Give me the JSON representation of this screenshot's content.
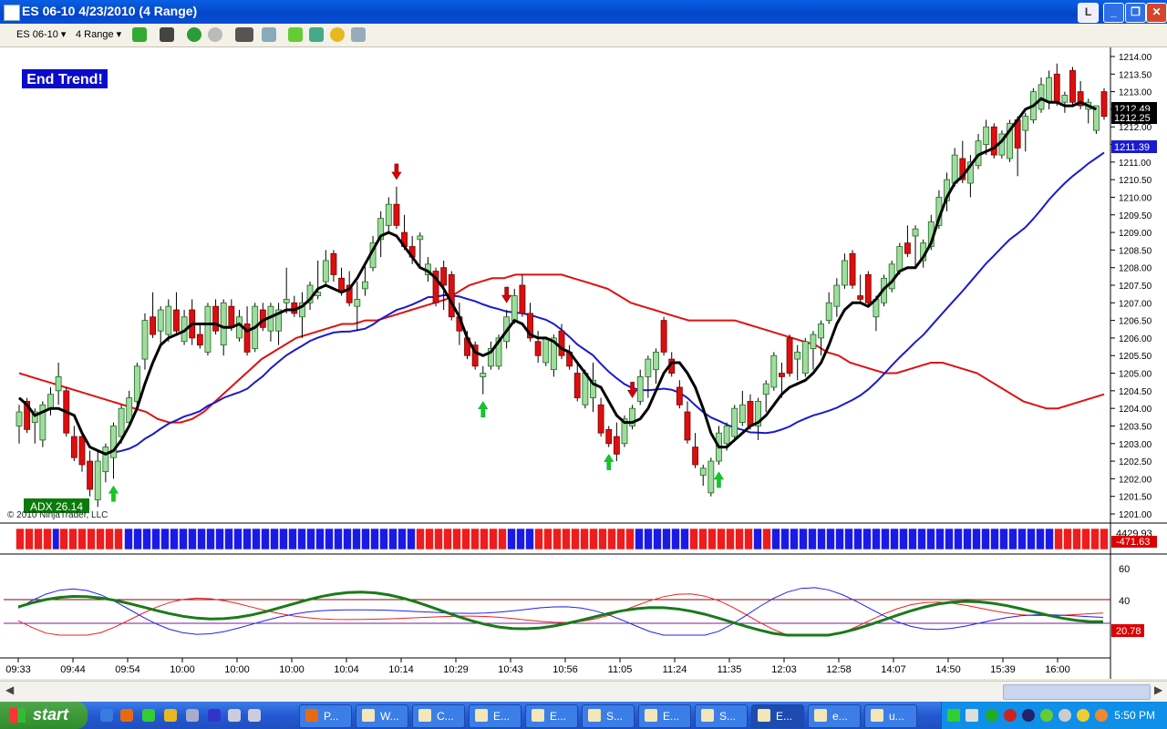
{
  "window": {
    "title": "ES 06-10  4/23/2010 (4 Range)",
    "buttons": [
      "L",
      "_",
      "❐",
      "✕"
    ]
  },
  "toolbar": {
    "instrument": "ES 06-10",
    "period": "4 Range"
  },
  "chart": {
    "banner": "End Trend!",
    "adx_label": "ADX 26.14",
    "copyright": "© 2010 NinjaTrader, LLC",
    "price_labels": {
      "last_1": "1212.49",
      "last_2": "1212.25",
      "blue_ma": "1211.39"
    },
    "trend_bar_labels": {
      "top": "4429.93",
      "bottom": "-471.63"
    },
    "dmi_label": "20.78",
    "time_labels": [
      "09:33",
      "09:44",
      "09:54",
      "10:00",
      "10:00",
      "10:00",
      "10:04",
      "10:14",
      "10:29",
      "10:43",
      "10:56",
      "11:05",
      "11:24",
      "11:35",
      "12:03",
      "12:58",
      "14:07",
      "14:50",
      "15:39",
      "16:00"
    ]
  },
  "chart_data": {
    "type": "candlestick",
    "instrument": "ES 06-10",
    "date": "4/23/2010",
    "bar_type": "4 Range",
    "price_axis": {
      "min": 1201.0,
      "max": 1214.0,
      "step": 0.5
    },
    "candles": [
      {
        "o": 1203.5,
        "h": 1204.1,
        "l": 1203.0,
        "c": 1203.9
      },
      {
        "o": 1204.2,
        "h": 1204.3,
        "l": 1203.3,
        "c": 1203.4
      },
      {
        "o": 1203.6,
        "h": 1204.0,
        "l": 1203.0,
        "c": 1203.9
      },
      {
        "o": 1203.1,
        "h": 1204.2,
        "l": 1202.9,
        "c": 1204.1
      },
      {
        "o": 1204.0,
        "h": 1204.6,
        "l": 1203.8,
        "c": 1204.4
      },
      {
        "o": 1204.5,
        "h": 1205.3,
        "l": 1204.1,
        "c": 1204.9
      },
      {
        "o": 1204.5,
        "h": 1204.6,
        "l": 1203.2,
        "c": 1203.3
      },
      {
        "o": 1203.2,
        "h": 1203.5,
        "l": 1202.5,
        "c": 1202.6
      },
      {
        "o": 1203.2,
        "h": 1203.3,
        "l": 1202.2,
        "c": 1202.4
      },
      {
        "o": 1202.5,
        "h": 1202.8,
        "l": 1201.5,
        "c": 1201.7
      },
      {
        "o": 1201.4,
        "h": 1202.8,
        "l": 1201.2,
        "c": 1202.5
      },
      {
        "o": 1202.2,
        "h": 1203.0,
        "l": 1201.9,
        "c": 1202.9
      },
      {
        "o": 1202.6,
        "h": 1203.6,
        "l": 1202.0,
        "c": 1203.5
      },
      {
        "o": 1203.2,
        "h": 1204.1,
        "l": 1203.0,
        "c": 1204.0
      },
      {
        "o": 1203.6,
        "h": 1204.5,
        "l": 1203.5,
        "c": 1204.3
      },
      {
        "o": 1204.2,
        "h": 1205.3,
        "l": 1204.0,
        "c": 1205.2
      },
      {
        "o": 1205.4,
        "h": 1206.7,
        "l": 1205.1,
        "c": 1206.5
      },
      {
        "o": 1206.6,
        "h": 1207.3,
        "l": 1206.0,
        "c": 1206.1
      },
      {
        "o": 1206.2,
        "h": 1206.9,
        "l": 1205.8,
        "c": 1206.8
      },
      {
        "o": 1206.1,
        "h": 1207.1,
        "l": 1205.9,
        "c": 1206.9
      },
      {
        "o": 1206.8,
        "h": 1207.3,
        "l": 1206.1,
        "c": 1206.2
      },
      {
        "o": 1205.9,
        "h": 1206.8,
        "l": 1205.8,
        "c": 1206.6
      },
      {
        "o": 1206.8,
        "h": 1207.1,
        "l": 1205.8,
        "c": 1206.0
      },
      {
        "o": 1206.1,
        "h": 1206.4,
        "l": 1205.7,
        "c": 1205.8
      },
      {
        "o": 1205.6,
        "h": 1207.0,
        "l": 1205.5,
        "c": 1206.9
      },
      {
        "o": 1206.9,
        "h": 1207.1,
        "l": 1206.1,
        "c": 1206.2
      },
      {
        "o": 1205.8,
        "h": 1207.1,
        "l": 1205.5,
        "c": 1207.0
      },
      {
        "o": 1206.9,
        "h": 1207.1,
        "l": 1206.2,
        "c": 1206.3
      },
      {
        "o": 1206.0,
        "h": 1206.8,
        "l": 1205.9,
        "c": 1206.6
      },
      {
        "o": 1206.4,
        "h": 1206.9,
        "l": 1205.5,
        "c": 1205.6
      },
      {
        "o": 1205.7,
        "h": 1207.0,
        "l": 1205.6,
        "c": 1206.9
      },
      {
        "o": 1206.8,
        "h": 1207.0,
        "l": 1206.2,
        "c": 1206.3
      },
      {
        "o": 1206.2,
        "h": 1207.0,
        "l": 1205.9,
        "c": 1206.9
      },
      {
        "o": 1206.2,
        "h": 1207.0,
        "l": 1205.8,
        "c": 1206.8
      },
      {
        "o": 1207.0,
        "h": 1208.0,
        "l": 1206.7,
        "c": 1207.1
      },
      {
        "o": 1207.0,
        "h": 1207.2,
        "l": 1206.6,
        "c": 1206.7
      },
      {
        "o": 1206.6,
        "h": 1207.3,
        "l": 1206.0,
        "c": 1207.0
      },
      {
        "o": 1207.0,
        "h": 1207.6,
        "l": 1206.8,
        "c": 1207.5
      },
      {
        "o": 1207.2,
        "h": 1208.2,
        "l": 1207.1,
        "c": 1207.3
      },
      {
        "o": 1207.6,
        "h": 1208.5,
        "l": 1207.5,
        "c": 1208.2
      },
      {
        "o": 1208.4,
        "h": 1208.5,
        "l": 1207.6,
        "c": 1207.8
      },
      {
        "o": 1207.7,
        "h": 1208.0,
        "l": 1207.2,
        "c": 1207.3
      },
      {
        "o": 1207.5,
        "h": 1207.9,
        "l": 1206.9,
        "c": 1207.0
      },
      {
        "o": 1206.9,
        "h": 1207.6,
        "l": 1206.2,
        "c": 1207.1
      },
      {
        "o": 1207.4,
        "h": 1208.1,
        "l": 1207.2,
        "c": 1207.6
      },
      {
        "o": 1208.0,
        "h": 1208.9,
        "l": 1207.9,
        "c": 1208.7
      },
      {
        "o": 1208.8,
        "h": 1209.6,
        "l": 1208.3,
        "c": 1209.4
      },
      {
        "o": 1209.2,
        "h": 1210.0,
        "l": 1209.0,
        "c": 1209.8
      },
      {
        "o": 1209.8,
        "h": 1210.3,
        "l": 1209.1,
        "c": 1209.2
      },
      {
        "o": 1209.0,
        "h": 1209.5,
        "l": 1208.5,
        "c": 1208.6
      },
      {
        "o": 1208.6,
        "h": 1208.9,
        "l": 1208.1,
        "c": 1208.3
      },
      {
        "o": 1208.8,
        "h": 1209.0,
        "l": 1208.0,
        "c": 1208.9
      },
      {
        "o": 1207.8,
        "h": 1208.3,
        "l": 1207.6,
        "c": 1208.1
      },
      {
        "o": 1207.9,
        "h": 1208.0,
        "l": 1206.9,
        "c": 1207.0
      },
      {
        "o": 1208.0,
        "h": 1208.2,
        "l": 1206.8,
        "c": 1207.5
      },
      {
        "o": 1207.8,
        "h": 1207.9,
        "l": 1206.5,
        "c": 1206.6
      },
      {
        "o": 1206.6,
        "h": 1207.0,
        "l": 1205.8,
        "c": 1206.2
      },
      {
        "o": 1206.0,
        "h": 1206.2,
        "l": 1205.4,
        "c": 1205.5
      },
      {
        "o": 1205.8,
        "h": 1205.9,
        "l": 1205.1,
        "c": 1205.2
      },
      {
        "o": 1204.9,
        "h": 1205.2,
        "l": 1204.4,
        "c": 1205.0
      },
      {
        "o": 1205.2,
        "h": 1205.9,
        "l": 1205.1,
        "c": 1205.7
      },
      {
        "o": 1205.2,
        "h": 1206.1,
        "l": 1205.1,
        "c": 1206.0
      },
      {
        "o": 1205.9,
        "h": 1206.8,
        "l": 1205.7,
        "c": 1206.6
      },
      {
        "o": 1206.5,
        "h": 1207.4,
        "l": 1206.4,
        "c": 1207.2
      },
      {
        "o": 1207.5,
        "h": 1207.8,
        "l": 1206.6,
        "c": 1206.7
      },
      {
        "o": 1206.7,
        "h": 1207.0,
        "l": 1205.9,
        "c": 1206.0
      },
      {
        "o": 1205.9,
        "h": 1206.2,
        "l": 1205.3,
        "c": 1205.5
      },
      {
        "o": 1205.3,
        "h": 1206.0,
        "l": 1205.2,
        "c": 1206.0
      },
      {
        "o": 1205.1,
        "h": 1206.1,
        "l": 1204.9,
        "c": 1206.0
      },
      {
        "o": 1206.2,
        "h": 1206.4,
        "l": 1205.4,
        "c": 1205.5
      },
      {
        "o": 1205.6,
        "h": 1205.8,
        "l": 1205.1,
        "c": 1205.2
      },
      {
        "o": 1205.0,
        "h": 1205.3,
        "l": 1204.2,
        "c": 1204.3
      },
      {
        "o": 1204.1,
        "h": 1205.1,
        "l": 1204.0,
        "c": 1205.0
      },
      {
        "o": 1204.3,
        "h": 1205.3,
        "l": 1203.9,
        "c": 1204.8
      },
      {
        "o": 1204.1,
        "h": 1204.3,
        "l": 1203.2,
        "c": 1203.3
      },
      {
        "o": 1203.4,
        "h": 1203.5,
        "l": 1202.9,
        "c": 1203.0
      },
      {
        "o": 1203.2,
        "h": 1203.6,
        "l": 1202.5,
        "c": 1202.7
      },
      {
        "o": 1203.0,
        "h": 1203.8,
        "l": 1202.9,
        "c": 1203.7
      },
      {
        "o": 1203.5,
        "h": 1204.1,
        "l": 1203.4,
        "c": 1204.0
      },
      {
        "o": 1204.2,
        "h": 1205.1,
        "l": 1204.1,
        "c": 1204.9
      },
      {
        "o": 1204.9,
        "h": 1205.5,
        "l": 1204.3,
        "c": 1205.4
      },
      {
        "o": 1205.1,
        "h": 1205.7,
        "l": 1204.7,
        "c": 1205.6
      },
      {
        "o": 1206.5,
        "h": 1206.6,
        "l": 1205.5,
        "c": 1205.6
      },
      {
        "o": 1205.4,
        "h": 1205.6,
        "l": 1204.9,
        "c": 1205.0
      },
      {
        "o": 1204.6,
        "h": 1204.8,
        "l": 1204.0,
        "c": 1204.1
      },
      {
        "o": 1203.9,
        "h": 1204.2,
        "l": 1203.0,
        "c": 1203.1
      },
      {
        "o": 1202.9,
        "h": 1203.3,
        "l": 1202.3,
        "c": 1202.4
      },
      {
        "o": 1202.1,
        "h": 1202.4,
        "l": 1201.8,
        "c": 1202.3
      },
      {
        "o": 1201.6,
        "h": 1202.6,
        "l": 1201.5,
        "c": 1202.5
      },
      {
        "o": 1202.5,
        "h": 1203.5,
        "l": 1202.4,
        "c": 1203.3
      },
      {
        "o": 1203.0,
        "h": 1203.6,
        "l": 1202.8,
        "c": 1203.5
      },
      {
        "o": 1203.2,
        "h": 1204.1,
        "l": 1203.1,
        "c": 1204.0
      },
      {
        "o": 1203.6,
        "h": 1204.5,
        "l": 1203.5,
        "c": 1204.1
      },
      {
        "o": 1204.2,
        "h": 1204.4,
        "l": 1203.4,
        "c": 1203.5
      },
      {
        "o": 1203.5,
        "h": 1204.3,
        "l": 1203.1,
        "c": 1204.2
      },
      {
        "o": 1204.4,
        "h": 1204.8,
        "l": 1203.9,
        "c": 1204.7
      },
      {
        "o": 1204.6,
        "h": 1205.6,
        "l": 1204.5,
        "c": 1205.5
      },
      {
        "o": 1205.0,
        "h": 1205.3,
        "l": 1204.3,
        "c": 1204.9
      },
      {
        "o": 1206.0,
        "h": 1206.1,
        "l": 1204.9,
        "c": 1205.0
      },
      {
        "o": 1205.4,
        "h": 1205.8,
        "l": 1204.8,
        "c": 1205.6
      },
      {
        "o": 1205.0,
        "h": 1206.0,
        "l": 1204.9,
        "c": 1205.9
      },
      {
        "o": 1205.7,
        "h": 1206.2,
        "l": 1205.1,
        "c": 1206.1
      },
      {
        "o": 1206.0,
        "h": 1206.5,
        "l": 1205.5,
        "c": 1206.4
      },
      {
        "o": 1206.5,
        "h": 1207.3,
        "l": 1206.4,
        "c": 1207.0
      },
      {
        "o": 1206.9,
        "h": 1207.7,
        "l": 1206.6,
        "c": 1207.5
      },
      {
        "o": 1207.5,
        "h": 1208.4,
        "l": 1207.4,
        "c": 1208.2
      },
      {
        "o": 1208.4,
        "h": 1208.5,
        "l": 1207.4,
        "c": 1207.5
      },
      {
        "o": 1207.2,
        "h": 1207.8,
        "l": 1207.0,
        "c": 1207.1
      },
      {
        "o": 1207.8,
        "h": 1207.9,
        "l": 1206.9,
        "c": 1207.0
      },
      {
        "o": 1206.6,
        "h": 1207.2,
        "l": 1206.2,
        "c": 1207.1
      },
      {
        "o": 1207.0,
        "h": 1207.8,
        "l": 1206.9,
        "c": 1207.7
      },
      {
        "o": 1207.4,
        "h": 1208.2,
        "l": 1207.3,
        "c": 1208.1
      },
      {
        "o": 1207.9,
        "h": 1208.7,
        "l": 1207.8,
        "c": 1208.6
      },
      {
        "o": 1208.7,
        "h": 1209.2,
        "l": 1208.3,
        "c": 1208.4
      },
      {
        "o": 1208.9,
        "h": 1209.2,
        "l": 1208.0,
        "c": 1209.1
      },
      {
        "o": 1208.2,
        "h": 1208.8,
        "l": 1208.0,
        "c": 1208.7
      },
      {
        "o": 1208.6,
        "h": 1209.5,
        "l": 1208.5,
        "c": 1209.3
      },
      {
        "o": 1209.2,
        "h": 1210.2,
        "l": 1209.1,
        "c": 1210.0
      },
      {
        "o": 1209.9,
        "h": 1210.7,
        "l": 1209.6,
        "c": 1210.5
      },
      {
        "o": 1210.4,
        "h": 1211.4,
        "l": 1210.3,
        "c": 1211.2
      },
      {
        "o": 1211.1,
        "h": 1211.6,
        "l": 1210.4,
        "c": 1210.5
      },
      {
        "o": 1210.4,
        "h": 1211.2,
        "l": 1210.0,
        "c": 1211.0
      },
      {
        "o": 1210.9,
        "h": 1211.8,
        "l": 1210.8,
        "c": 1211.6
      },
      {
        "o": 1211.5,
        "h": 1212.2,
        "l": 1211.2,
        "c": 1212.0
      },
      {
        "o": 1212.0,
        "h": 1212.1,
        "l": 1211.1,
        "c": 1211.2
      },
      {
        "o": 1211.2,
        "h": 1211.9,
        "l": 1211.1,
        "c": 1211.8
      },
      {
        "o": 1211.1,
        "h": 1212.2,
        "l": 1211.0,
        "c": 1212.1
      },
      {
        "o": 1212.2,
        "h": 1212.3,
        "l": 1210.6,
        "c": 1211.4
      },
      {
        "o": 1211.9,
        "h": 1212.4,
        "l": 1211.3,
        "c": 1212.3
      },
      {
        "o": 1212.2,
        "h": 1213.1,
        "l": 1212.1,
        "c": 1213.0
      },
      {
        "o": 1212.5,
        "h": 1213.4,
        "l": 1212.4,
        "c": 1213.2
      },
      {
        "o": 1212.7,
        "h": 1213.6,
        "l": 1212.5,
        "c": 1213.4
      },
      {
        "o": 1213.5,
        "h": 1213.8,
        "l": 1212.6,
        "c": 1212.7
      },
      {
        "o": 1212.7,
        "h": 1213.0,
        "l": 1212.4,
        "c": 1212.9
      },
      {
        "o": 1213.6,
        "h": 1213.7,
        "l": 1212.6,
        "c": 1212.7
      },
      {
        "o": 1213.0,
        "h": 1213.3,
        "l": 1212.5,
        "c": 1212.6
      },
      {
        "o": 1212.5,
        "h": 1212.8,
        "l": 1212.1,
        "c": 1212.7
      },
      {
        "o": 1211.9,
        "h": 1212.6,
        "l": 1211.8,
        "c": 1212.6
      },
      {
        "o": 1213.0,
        "h": 1213.1,
        "l": 1212.2,
        "c": 1212.3
      }
    ],
    "ema_fast_black": [
      1204.3,
      1204.1,
      1203.8,
      1203.9,
      1204.0,
      1204.0,
      1203.9,
      1203.8,
      1203.3,
      1202.9,
      1202.8,
      1202.7,
      1202.8,
      1203.1,
      1203.5,
      1204.0,
      1204.7,
      1205.3,
      1205.8,
      1206.0,
      1206.1,
      1206.2,
      1206.4,
      1206.4,
      1206.4,
      1206.4,
      1206.3,
      1206.3,
      1206.4,
      1206.2,
      1206.3,
      1206.5,
      1206.6,
      1206.7,
      1206.8,
      1206.8,
      1206.9,
      1207.1,
      1207.4,
      1207.5,
      1207.4,
      1207.3,
      1207.4,
      1207.7,
      1208.1,
      1208.5,
      1208.9,
      1209.0,
      1208.9,
      1208.6,
      1208.3,
      1208.0,
      1207.9,
      1207.7,
      1207.4,
      1207.0,
      1206.6,
      1206.0,
      1205.6,
      1205.5,
      1205.6,
      1205.9,
      1206.2,
      1206.5,
      1206.4,
      1206.1,
      1206.0,
      1206.0,
      1205.9,
      1205.7,
      1205.6,
      1205.3,
      1205.0,
      1204.7,
      1204.6,
      1204.2,
      1203.8,
      1203.6,
      1203.6,
      1203.7,
      1204.0,
      1204.5,
      1205.0,
      1205.3,
      1205.3,
      1205.0,
      1204.6,
      1204.0,
      1203.3,
      1202.9,
      1202.9,
      1203.1,
      1203.3,
      1203.5,
      1203.6,
      1203.8,
      1204.1,
      1204.4,
      1204.6,
      1204.7,
      1204.8,
      1205.0,
      1205.3,
      1205.8,
      1206.4,
      1206.8,
      1207.0,
      1207.0,
      1206.9,
      1207.1,
      1207.4,
      1207.6,
      1207.9,
      1208.0,
      1208.0,
      1208.3,
      1208.7,
      1209.4,
      1210.0,
      1210.4,
      1210.6,
      1210.9,
      1211.2,
      1211.3,
      1211.4,
      1211.6,
      1211.9,
      1212.2,
      1212.5,
      1212.6,
      1212.8,
      1212.7,
      1212.7,
      1212.6,
      1212.6,
      1212.7,
      1212.6,
      1212.5
    ],
    "ema_mid_red": [
      1205.0,
      1204.9,
      1204.8,
      1204.7,
      1204.6,
      1204.5,
      1204.4,
      1204.3,
      1204.2,
      1204.1,
      1204.0,
      1203.9,
      1203.7,
      1203.6,
      1203.6,
      1203.7,
      1203.9,
      1204.2,
      1204.5,
      1204.8,
      1205.1,
      1205.4,
      1205.6,
      1205.8,
      1206.0,
      1206.1,
      1206.2,
      1206.3,
      1206.4,
      1206.4,
      1206.5,
      1206.5,
      1206.6,
      1206.7,
      1206.8,
      1206.9,
      1207.0,
      1207.1,
      1207.3,
      1207.5,
      1207.6,
      1207.7,
      1207.7,
      1207.8,
      1207.8,
      1207.8,
      1207.8,
      1207.8,
      1207.7,
      1207.6,
      1207.5,
      1207.4,
      1207.2,
      1207.0,
      1206.9,
      1206.8,
      1206.7,
      1206.6,
      1206.5,
      1206.5,
      1206.5,
      1206.5,
      1206.5,
      1206.4,
      1206.3,
      1206.2,
      1206.1,
      1206.0,
      1205.9,
      1205.8,
      1205.6,
      1205.5,
      1205.3,
      1205.2,
      1205.1,
      1205.0,
      1205.0,
      1205.1,
      1205.2,
      1205.3,
      1205.3,
      1205.2,
      1205.1,
      1205.0,
      1204.8,
      1204.6,
      1204.4,
      1204.2,
      1204.1,
      1204.0,
      1204.0,
      1204.1,
      1204.2,
      1204.3,
      1204.4
    ]
  }
}
